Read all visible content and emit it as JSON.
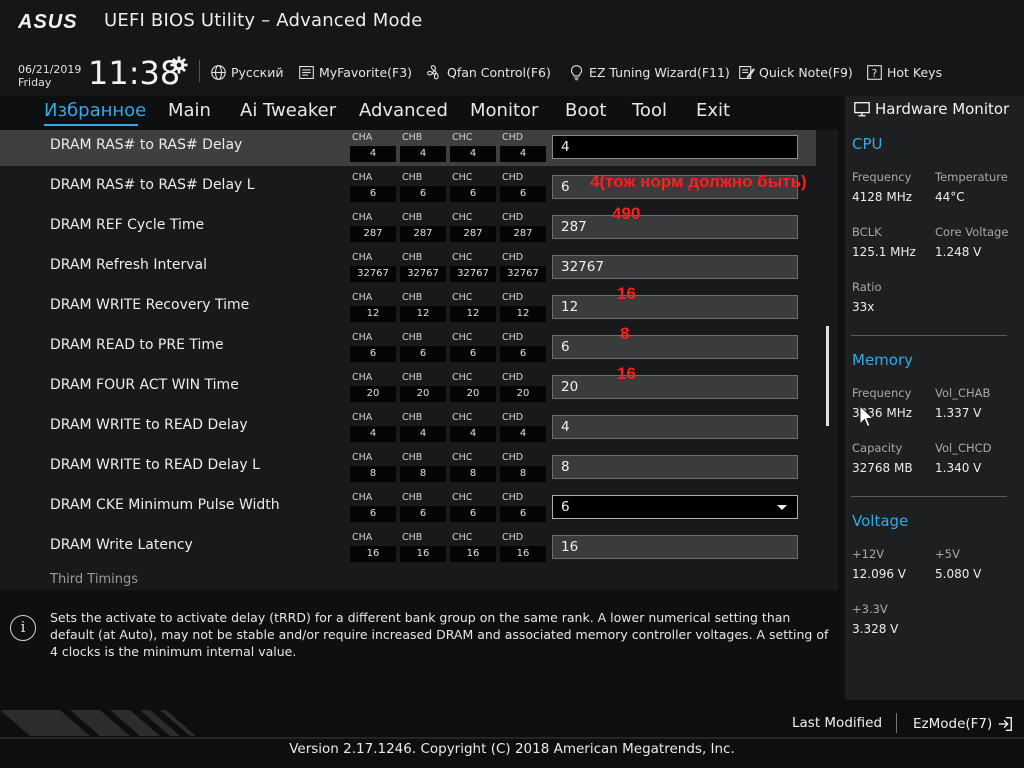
{
  "header": {
    "brand": "ASUS",
    "title": "UEFI BIOS Utility – Advanced Mode",
    "date": "06/21/2019",
    "day": "Friday",
    "time": "11:38",
    "toolbar": [
      {
        "label": "Русский",
        "icon": "globe-icon"
      },
      {
        "label": "MyFavorite(F3)",
        "icon": "favorite-list-icon"
      },
      {
        "label": "Qfan Control(F6)",
        "icon": "fan-icon"
      },
      {
        "label": "EZ Tuning Wizard(F11)",
        "icon": "lightbulb-icon"
      },
      {
        "label": "Quick Note(F9)",
        "icon": "note-icon"
      },
      {
        "label": "Hot Keys",
        "icon": "question-icon"
      }
    ]
  },
  "nav": {
    "tabs": [
      "Избранное",
      "Main",
      "Ai Tweaker",
      "Advanced",
      "Monitor",
      "Boot",
      "Tool",
      "Exit"
    ],
    "active": "Избранное"
  },
  "channels": [
    "CHA",
    "CHB",
    "CHC",
    "CHD"
  ],
  "settings": [
    {
      "label": "DRAM RAS# to RAS# Delay",
      "ch": [
        "4",
        "4",
        "4",
        "4"
      ],
      "value": "4",
      "selected": true
    },
    {
      "label": "DRAM RAS# to RAS# Delay L",
      "ch": [
        "6",
        "6",
        "6",
        "6"
      ],
      "value": "6",
      "note": "4(тож норм должно быть)"
    },
    {
      "label": "DRAM REF Cycle Time",
      "ch": [
        "287",
        "287",
        "287",
        "287"
      ],
      "value": "287",
      "note": "490"
    },
    {
      "label": "DRAM Refresh Interval",
      "ch": [
        "32767",
        "32767",
        "32767",
        "32767"
      ],
      "value": "32767"
    },
    {
      "label": "DRAM WRITE Recovery Time",
      "ch": [
        "12",
        "12",
        "12",
        "12"
      ],
      "value": "12",
      "note": "16"
    },
    {
      "label": "DRAM READ to PRE Time",
      "ch": [
        "6",
        "6",
        "6",
        "6"
      ],
      "value": "6",
      "note": "8"
    },
    {
      "label": "DRAM FOUR ACT WIN Time",
      "ch": [
        "20",
        "20",
        "20",
        "20"
      ],
      "value": "20",
      "note": "16"
    },
    {
      "label": "DRAM WRITE to READ Delay",
      "ch": [
        "4",
        "4",
        "4",
        "4"
      ],
      "value": "4"
    },
    {
      "label": "DRAM WRITE to READ Delay L",
      "ch": [
        "8",
        "8",
        "8",
        "8"
      ],
      "value": "8"
    },
    {
      "label": "DRAM CKE Minimum Pulse Width",
      "ch": [
        "6",
        "6",
        "6",
        "6"
      ],
      "value": "6",
      "dropdown": true
    },
    {
      "label": "DRAM Write Latency",
      "ch": [
        "16",
        "16",
        "16",
        "16"
      ],
      "value": "16"
    }
  ],
  "section_title": "Third Timings",
  "help_text": "Sets the activate to activate delay (tRRD) for a different bank group on the same rank. A lower numerical setting than default (at Auto), may not be stable and/or require increased DRAM and associated memory controller voltages. A setting of 4 clocks is the minimum internal value.",
  "hw": {
    "title": "Hardware Monitor",
    "cpu": {
      "title": "CPU",
      "frequency_label": "Frequency",
      "frequency": "4128 MHz",
      "temperature_label": "Temperature",
      "temperature": "44°C",
      "bclk_label": "BCLK",
      "bclk": "125.1 MHz",
      "core_voltage_label": "Core Voltage",
      "core_voltage": "1.248 V",
      "ratio_label": "Ratio",
      "ratio": "33x"
    },
    "memory": {
      "title": "Memory",
      "frequency_label": "Frequency",
      "frequency": "3336 MHz",
      "vol_chab_label": "Vol_CHAB",
      "vol_chab": "1.337 V",
      "capacity_label": "Capacity",
      "capacity": "32768 MB",
      "vol_chcd_label": "Vol_CHCD",
      "vol_chcd": "1.340 V"
    },
    "voltage": {
      "title": "Voltage",
      "v12_label": "+12V",
      "v12": "12.096 V",
      "v5_label": "+5V",
      "v5": "5.080 V",
      "v33_label": "+3.3V",
      "v33": "3.328 V"
    }
  },
  "footer": {
    "last_modified": "Last Modified",
    "ezmode": "EzMode(F7)",
    "copyright": "Version 2.17.1246. Copyright (C) 2018 American Megatrends, Inc."
  },
  "colors": {
    "accent": "#37a8e6",
    "annotation": "#ff1e1e",
    "background": "#0e0f10"
  }
}
